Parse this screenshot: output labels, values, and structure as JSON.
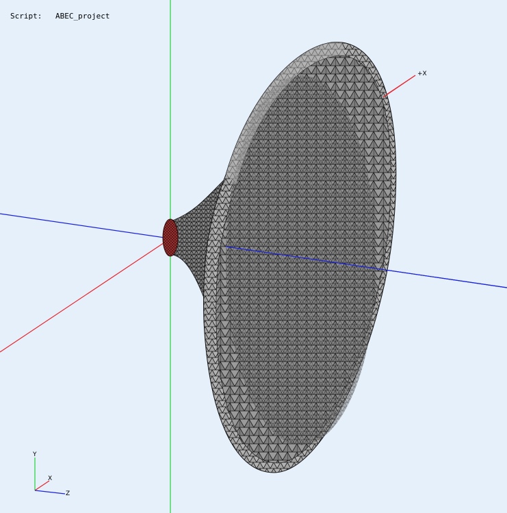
{
  "script": {
    "label": "Script:",
    "value": "ABEC_project"
  },
  "axes": {
    "plus_x_label": "+X",
    "triad_y": "Y",
    "triad_x": "X",
    "triad_z": "Z"
  },
  "colors": {
    "background": "#e6f0fb",
    "x_axis": "#e8262e",
    "y_axis": "#22d13a",
    "z_axis": "#1a22e0",
    "mesh_fill": "#8c8c8c",
    "mesh_edge": "#111111",
    "throat": "#7a1a1a"
  },
  "icons": {
    "horn_mesh": "horn-mesh-icon",
    "axis_triad": "axis-triad-icon"
  }
}
